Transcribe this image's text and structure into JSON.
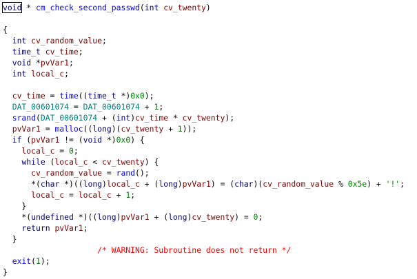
{
  "window": {
    "title": "cm_check_second_passwd"
  },
  "code_lines": [
    {
      "tokens": [
        {
          "t": "void",
          "c": "ty",
          "box": true
        },
        {
          "t": " * ",
          "c": "plain"
        },
        {
          "t": "cm_check_second_passwd",
          "c": "fn"
        },
        {
          "t": "(",
          "c": "plain"
        },
        {
          "t": "int",
          "c": "ty"
        },
        {
          "t": " ",
          "c": "plain"
        },
        {
          "t": "cv_twenty",
          "c": "var"
        },
        {
          "t": ")",
          "c": "plain"
        }
      ]
    },
    {
      "tokens": []
    },
    {
      "tokens": [
        {
          "t": "{",
          "c": "plain"
        }
      ]
    },
    {
      "tokens": [
        {
          "t": "  ",
          "c": "plain"
        },
        {
          "t": "int",
          "c": "ty"
        },
        {
          "t": " ",
          "c": "plain"
        },
        {
          "t": "cv_random_value",
          "c": "var"
        },
        {
          "t": ";",
          "c": "plain"
        }
      ]
    },
    {
      "tokens": [
        {
          "t": "  ",
          "c": "plain"
        },
        {
          "t": "time_t",
          "c": "ty"
        },
        {
          "t": " ",
          "c": "plain"
        },
        {
          "t": "cv_time",
          "c": "var"
        },
        {
          "t": ";",
          "c": "plain"
        }
      ]
    },
    {
      "tokens": [
        {
          "t": "  ",
          "c": "plain"
        },
        {
          "t": "void",
          "c": "ty"
        },
        {
          "t": " *",
          "c": "plain"
        },
        {
          "t": "pvVar1",
          "c": "var"
        },
        {
          "t": ";",
          "c": "plain"
        }
      ]
    },
    {
      "tokens": [
        {
          "t": "  ",
          "c": "plain"
        },
        {
          "t": "int",
          "c": "ty"
        },
        {
          "t": " ",
          "c": "plain"
        },
        {
          "t": "local_c",
          "c": "var"
        },
        {
          "t": ";",
          "c": "plain"
        }
      ]
    },
    {
      "tokens": []
    },
    {
      "tokens": [
        {
          "t": "  ",
          "c": "plain"
        },
        {
          "t": "cv_time",
          "c": "var"
        },
        {
          "t": " = ",
          "c": "plain"
        },
        {
          "t": "time",
          "c": "fn"
        },
        {
          "t": "((",
          "c": "plain"
        },
        {
          "t": "time_t",
          "c": "ty"
        },
        {
          "t": " *)",
          "c": "plain"
        },
        {
          "t": "0x0",
          "c": "num"
        },
        {
          "t": ");",
          "c": "plain"
        }
      ]
    },
    {
      "tokens": [
        {
          "t": "  ",
          "c": "plain"
        },
        {
          "t": "DAT_00601074",
          "c": "gv"
        },
        {
          "t": " = ",
          "c": "plain"
        },
        {
          "t": "DAT_00601074",
          "c": "gv"
        },
        {
          "t": " + ",
          "c": "plain"
        },
        {
          "t": "1",
          "c": "num"
        },
        {
          "t": ";",
          "c": "plain"
        }
      ]
    },
    {
      "tokens": [
        {
          "t": "  ",
          "c": "plain"
        },
        {
          "t": "srand",
          "c": "fn"
        },
        {
          "t": "(",
          "c": "plain"
        },
        {
          "t": "DAT_00601074",
          "c": "gv"
        },
        {
          "t": " + (",
          "c": "plain"
        },
        {
          "t": "int",
          "c": "ty"
        },
        {
          "t": ")",
          "c": "plain"
        },
        {
          "t": "cv_time",
          "c": "var"
        },
        {
          "t": " * ",
          "c": "plain"
        },
        {
          "t": "cv_twenty",
          "c": "var"
        },
        {
          "t": ");",
          "c": "plain"
        }
      ]
    },
    {
      "tokens": [
        {
          "t": "  ",
          "c": "plain"
        },
        {
          "t": "pvVar1",
          "c": "var"
        },
        {
          "t": " = ",
          "c": "plain"
        },
        {
          "t": "malloc",
          "c": "fn"
        },
        {
          "t": "((",
          "c": "plain"
        },
        {
          "t": "long",
          "c": "ty"
        },
        {
          "t": ")(",
          "c": "plain"
        },
        {
          "t": "cv_twenty",
          "c": "var"
        },
        {
          "t": " + ",
          "c": "plain"
        },
        {
          "t": "1",
          "c": "num"
        },
        {
          "t": "));",
          "c": "plain"
        }
      ]
    },
    {
      "tokens": [
        {
          "t": "  ",
          "c": "plain"
        },
        {
          "t": "if",
          "c": "kw"
        },
        {
          "t": " (",
          "c": "plain"
        },
        {
          "t": "pvVar1",
          "c": "var"
        },
        {
          "t": " != (",
          "c": "plain"
        },
        {
          "t": "void",
          "c": "ty"
        },
        {
          "t": " *)",
          "c": "plain"
        },
        {
          "t": "0x0",
          "c": "num"
        },
        {
          "t": ") {",
          "c": "plain"
        }
      ]
    },
    {
      "tokens": [
        {
          "t": "    ",
          "c": "plain"
        },
        {
          "t": "local_c",
          "c": "var"
        },
        {
          "t": " = ",
          "c": "plain"
        },
        {
          "t": "0",
          "c": "num"
        },
        {
          "t": ";",
          "c": "plain"
        }
      ]
    },
    {
      "tokens": [
        {
          "t": "    ",
          "c": "plain"
        },
        {
          "t": "while",
          "c": "kw"
        },
        {
          "t": " (",
          "c": "plain"
        },
        {
          "t": "local_c",
          "c": "var"
        },
        {
          "t": " < ",
          "c": "plain"
        },
        {
          "t": "cv_twenty",
          "c": "var"
        },
        {
          "t": ") {",
          "c": "plain"
        }
      ]
    },
    {
      "tokens": [
        {
          "t": "      ",
          "c": "plain"
        },
        {
          "t": "cv_random_value",
          "c": "var"
        },
        {
          "t": " = ",
          "c": "plain"
        },
        {
          "t": "rand",
          "c": "fn"
        },
        {
          "t": "();",
          "c": "plain"
        }
      ]
    },
    {
      "tokens": [
        {
          "t": "      *(",
          "c": "plain"
        },
        {
          "t": "char",
          "c": "ty"
        },
        {
          "t": " *)((",
          "c": "plain"
        },
        {
          "t": "long",
          "c": "ty"
        },
        {
          "t": ")",
          "c": "plain"
        },
        {
          "t": "local_c",
          "c": "var"
        },
        {
          "t": " + (",
          "c": "plain"
        },
        {
          "t": "long",
          "c": "ty"
        },
        {
          "t": ")",
          "c": "plain"
        },
        {
          "t": "pvVar1",
          "c": "var"
        },
        {
          "t": ") = (",
          "c": "plain"
        },
        {
          "t": "char",
          "c": "ty"
        },
        {
          "t": ")(",
          "c": "plain"
        },
        {
          "t": "cv_random_value",
          "c": "var"
        },
        {
          "t": " % ",
          "c": "plain"
        },
        {
          "t": "0x5e",
          "c": "num"
        },
        {
          "t": ") + ",
          "c": "plain"
        },
        {
          "t": "'!'",
          "c": "num"
        },
        {
          "t": ";",
          "c": "plain"
        }
      ]
    },
    {
      "tokens": [
        {
          "t": "      ",
          "c": "plain"
        },
        {
          "t": "local_c",
          "c": "var"
        },
        {
          "t": " = ",
          "c": "plain"
        },
        {
          "t": "local_c",
          "c": "var"
        },
        {
          "t": " + ",
          "c": "plain"
        },
        {
          "t": "1",
          "c": "num"
        },
        {
          "t": ";",
          "c": "plain"
        }
      ]
    },
    {
      "tokens": [
        {
          "t": "    }",
          "c": "plain"
        }
      ]
    },
    {
      "tokens": [
        {
          "t": "    *(",
          "c": "plain"
        },
        {
          "t": "undefined",
          "c": "ty"
        },
        {
          "t": " *)((",
          "c": "plain"
        },
        {
          "t": "long",
          "c": "ty"
        },
        {
          "t": ")",
          "c": "plain"
        },
        {
          "t": "pvVar1",
          "c": "var"
        },
        {
          "t": " + (",
          "c": "plain"
        },
        {
          "t": "long",
          "c": "ty"
        },
        {
          "t": ")",
          "c": "plain"
        },
        {
          "t": "cv_twenty",
          "c": "var"
        },
        {
          "t": ") = ",
          "c": "plain"
        },
        {
          "t": "0",
          "c": "num"
        },
        {
          "t": ";",
          "c": "plain"
        }
      ]
    },
    {
      "tokens": [
        {
          "t": "    ",
          "c": "plain"
        },
        {
          "t": "return",
          "c": "kw"
        },
        {
          "t": " ",
          "c": "plain"
        },
        {
          "t": "pvVar1",
          "c": "var"
        },
        {
          "t": ";",
          "c": "plain"
        }
      ]
    },
    {
      "tokens": [
        {
          "t": "  }",
          "c": "plain"
        }
      ]
    },
    {
      "tokens": [
        {
          "t": "                    ",
          "c": "plain"
        },
        {
          "t": "/* WARNING: Subroutine does not return */",
          "c": "cm"
        }
      ]
    },
    {
      "tokens": [
        {
          "t": "  ",
          "c": "plain"
        },
        {
          "t": "exit",
          "c": "fn"
        },
        {
          "t": "(",
          "c": "plain"
        },
        {
          "t": "1",
          "c": "num"
        },
        {
          "t": ");",
          "c": "plain"
        }
      ]
    },
    {
      "tokens": [
        {
          "t": "}",
          "c": "plain"
        }
      ]
    }
  ],
  "colors": {
    "background": "#ffffff",
    "keyword": "#000080",
    "type": "#000080",
    "function": "#0000ff",
    "variable": "#800000",
    "number": "#008000",
    "global": "#008080",
    "comment": "#ff0000"
  }
}
